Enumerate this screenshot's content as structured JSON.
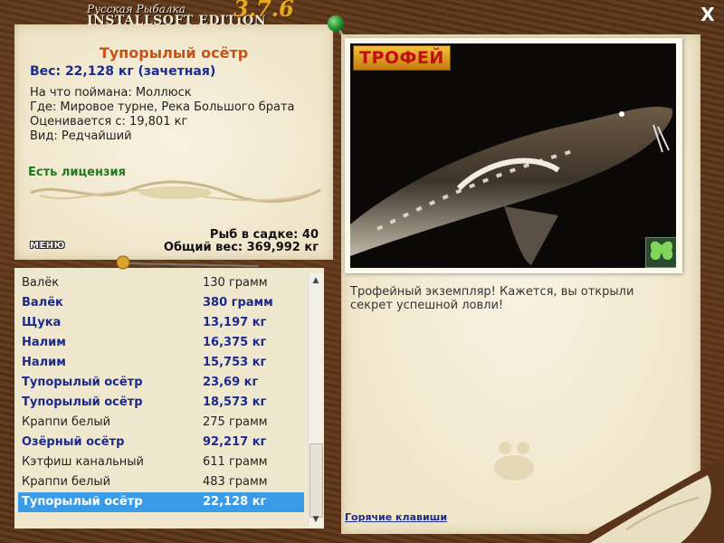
{
  "app": {
    "title_line1": "Русская Рыбалка",
    "title_line2": "INSTALLSOFT EDITION",
    "version": "3.7.6",
    "close_label": "X"
  },
  "catch": {
    "name": "Тупорылый осётр",
    "weight_line": "Вес: 22,128 кг (зачетная)",
    "bait_line": "На что поймана: Моллюск",
    "place_line": "Где: Мировое турне, Река Большого брата",
    "value_line": "Оценивается с: 19,801 кг",
    "kind_line": "Вид: Редчайший",
    "license": "Есть лицензия"
  },
  "stats": {
    "fish_count": "Рыб в садке: 40",
    "total_weight": "Общий вес: 369,992 кг"
  },
  "menu_label": "МЕНЮ",
  "fish_list": [
    {
      "name": "Валёк",
      "weight": "130 грамм",
      "bold": false
    },
    {
      "name": "Валёк",
      "weight": "380 грамм",
      "bold": true
    },
    {
      "name": "Щука",
      "weight": "13,197 кг",
      "bold": true
    },
    {
      "name": "Налим",
      "weight": "16,375 кг",
      "bold": true
    },
    {
      "name": "Налим",
      "weight": "15,753 кг",
      "bold": true
    },
    {
      "name": "Тупорылый осётр",
      "weight": "23,69 кг",
      "bold": true
    },
    {
      "name": "Тупорылый осётр",
      "weight": "18,573 кг",
      "bold": true
    },
    {
      "name": "Краппи белый",
      "weight": "275 грамм",
      "bold": false
    },
    {
      "name": "Озёрный осётр",
      "weight": "92,217 кг",
      "bold": true
    },
    {
      "name": "Кэтфиш канальный",
      "weight": "611 грамм",
      "bold": false
    },
    {
      "name": "Краппи белый",
      "weight": "483 грамм",
      "bold": false
    },
    {
      "name": "Тупорылый осётр",
      "weight": "22,128 кг",
      "bold": true,
      "selected": true
    }
  ],
  "trophy_badge": "ТРОФЕЙ",
  "description": "Трофейный экземпляр! Кажется, вы открыли секрет успешной ловли!",
  "hotkeys_link": "Горячие клавиши",
  "colors": {
    "accent_title": "#c4541a",
    "accent_blue": "#1b2a8c",
    "license_green": "#1f7a1f",
    "selection": "#3a9ce8"
  },
  "icons": [
    "close-icon",
    "pin-icon",
    "butterfly-icon",
    "scroll-up-icon",
    "scroll-down-icon"
  ]
}
